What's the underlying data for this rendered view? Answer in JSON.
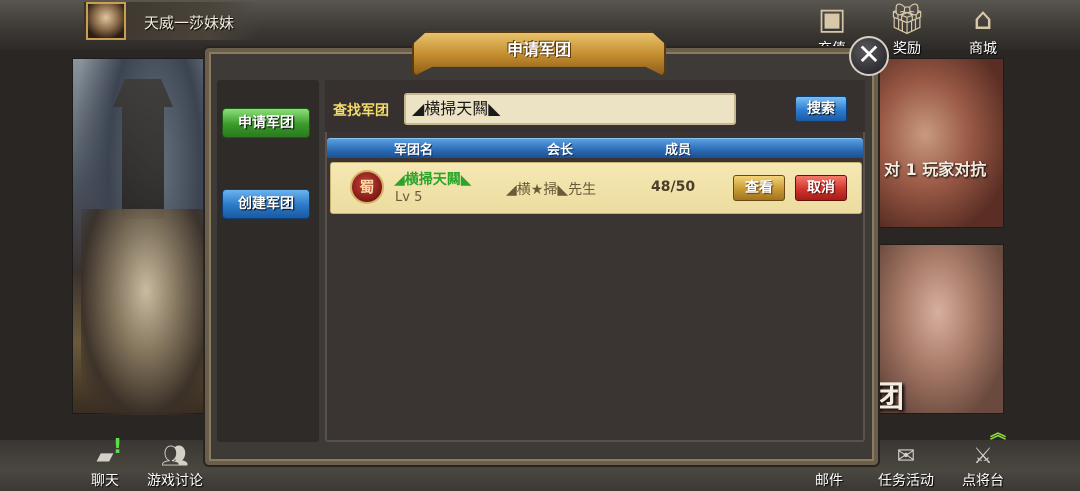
{
  "player": {
    "name": "天威一莎妹妹"
  },
  "top_icons": [
    {
      "label": "充值",
      "icon": "treasure-chest-icon"
    },
    {
      "label": "奖励",
      "icon": "gift-box-icon"
    },
    {
      "label": "商城",
      "icon": "pagoda-icon"
    }
  ],
  "background": {
    "pvp_label": "对 1 玩家对抗",
    "legion_label": "军团"
  },
  "dialog": {
    "title": "申请军团",
    "close_glyph": "✕",
    "side_buttons": {
      "apply": "申请军团",
      "create": "创建军团"
    },
    "search": {
      "label": "查找军团",
      "value": "◢横掃天闗◣",
      "button": "搜索"
    },
    "table": {
      "headers": {
        "name": "军团名",
        "leader": "会长",
        "members": "成员"
      },
      "rows": [
        {
          "emblem": "蜀",
          "name": "◢横掃天闗◣",
          "level": "Lv 5",
          "leader": "◢横★掃◣先生",
          "members": "48/50",
          "view_label": "查看",
          "cancel_label": "取消"
        }
      ]
    }
  },
  "bottom_left": [
    {
      "label": "聊天",
      "icon": "chat-bubble-icon",
      "badge": "!"
    },
    {
      "label": "游戏讨论",
      "icon": "people-icon"
    }
  ],
  "bottom_right": [
    {
      "label": "邮件",
      "icon": "mail-icon"
    },
    {
      "label": "任务活动",
      "icon": "scroll-icon"
    },
    {
      "label": "点将台",
      "icon": "crossed-swords-icon",
      "badge": "︽"
    }
  ]
}
